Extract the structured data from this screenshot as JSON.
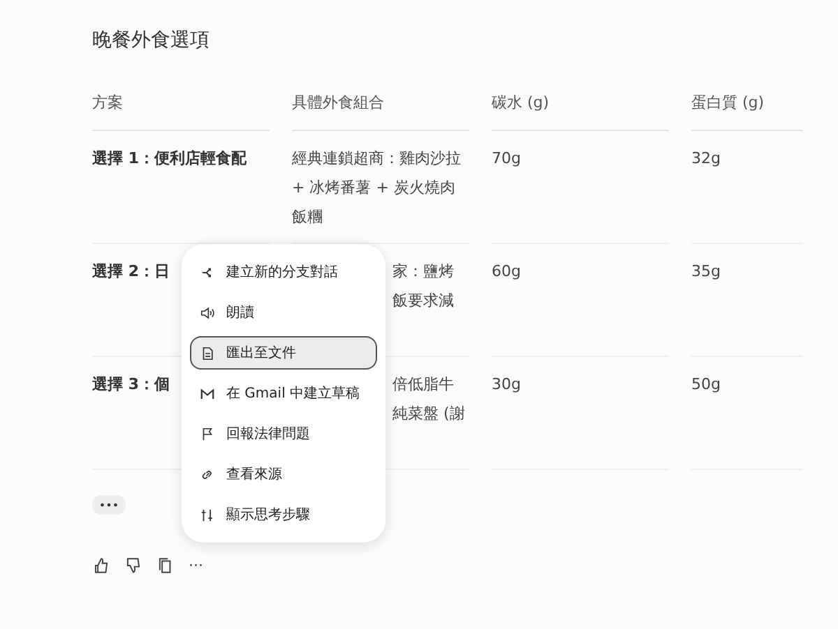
{
  "title": "晚餐外食選項",
  "table": {
    "columns": [
      "方案",
      "具體外食組合",
      "碳水 (g)",
      "蛋白質 (g)"
    ],
    "rows": [
      {
        "cells": [
          [
            "選擇 1：便利店輕食配"
          ],
          [
            "經典連鎖超商：雞肉沙拉 + 冰烤番薯 + 炭火燒肉飯糰"
          ],
          [
            "70g"
          ],
          [
            "32g"
          ]
        ]
      },
      {
        "cells": [
          [
            "選擇 2：日"
          ],
          [
            "家：鹽烤",
            "飯要求減"
          ],
          [
            "60g"
          ],
          [
            "35g"
          ]
        ]
      },
      {
        "cells": [
          [
            "選擇 3：個"
          ],
          [
            "倍低脂牛",
            "純菜盤 (謝"
          ],
          [
            "30g"
          ],
          [
            "50g"
          ]
        ]
      }
    ]
  },
  "menu": {
    "items": [
      {
        "label": "建立新的分支對話",
        "selected": false
      },
      {
        "label": "朗讀",
        "selected": false
      },
      {
        "label": "匯出至文件",
        "selected": true
      },
      {
        "label": "在 Gmail 中建立草稿",
        "selected": false
      },
      {
        "label": "回報法律問題",
        "selected": false
      },
      {
        "label": "查看來源",
        "selected": false
      },
      {
        "label": "顯示思考步驟",
        "selected": false
      }
    ]
  },
  "collapsed_chip": "•••",
  "actions": {
    "more": "···"
  }
}
